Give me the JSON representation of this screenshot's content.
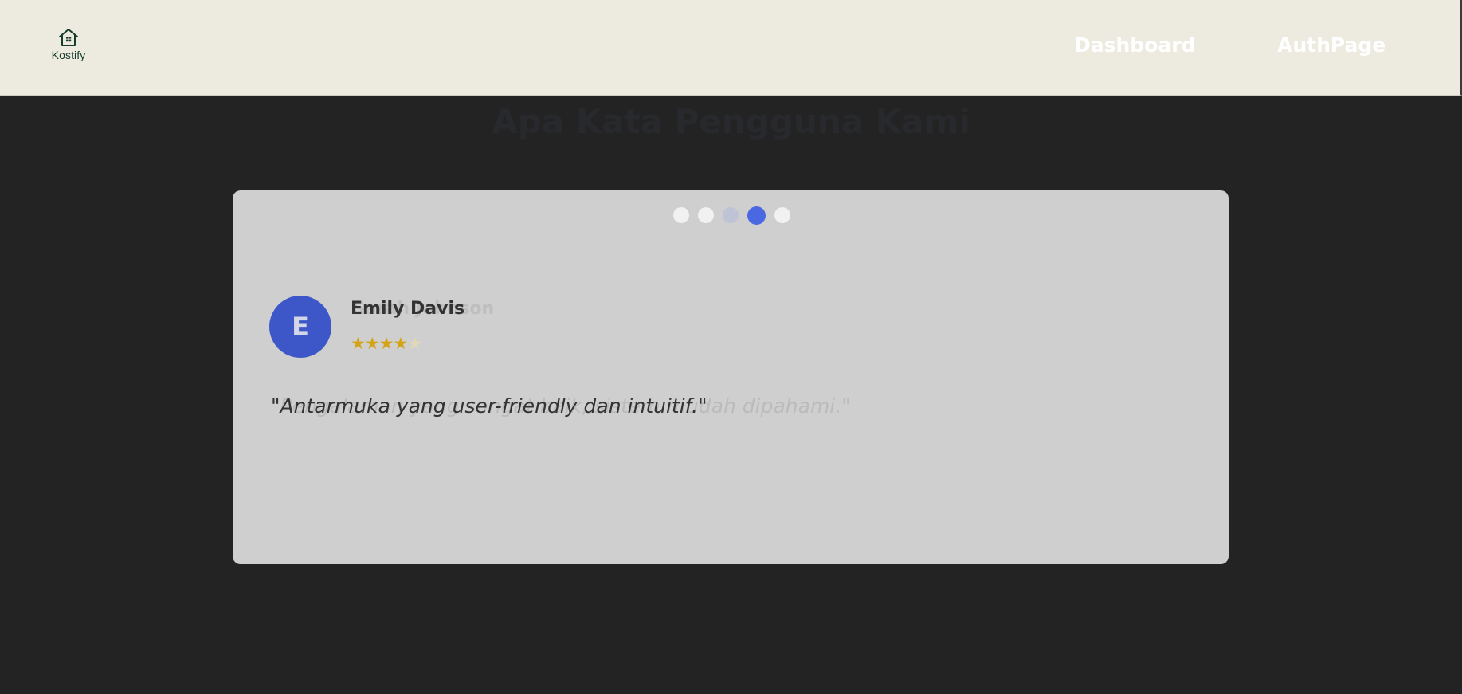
{
  "header": {
    "logo_text": "Kostify",
    "logo_icon": "house-icon",
    "nav": [
      {
        "label": "Dashboard"
      },
      {
        "label": "AuthPage"
      }
    ]
  },
  "testimonials": {
    "title": "Apa Kata Pengguna Kami",
    "active_index": 3,
    "dot_count": 5,
    "current": {
      "initial": "E",
      "name": "Emily Davis",
      "rating": 4,
      "max_rating": 5,
      "stars_filled": "★★★★",
      "stars_empty": "★",
      "quote": "\"Antarmuka yang user-friendly dan intuitif.\""
    },
    "previous": {
      "name": "Sarah Johnson",
      "quote": "\"Pengalaman yang sangat baik, sistem mudah dipahami.\""
    }
  },
  "colors": {
    "navbar_bg": "#edeadf",
    "page_bg": "#232323",
    "card_bg": "#cfcfcf",
    "accent": "#4a68e2",
    "avatar_bg": "#3d57c8",
    "star": "#d4a418"
  }
}
